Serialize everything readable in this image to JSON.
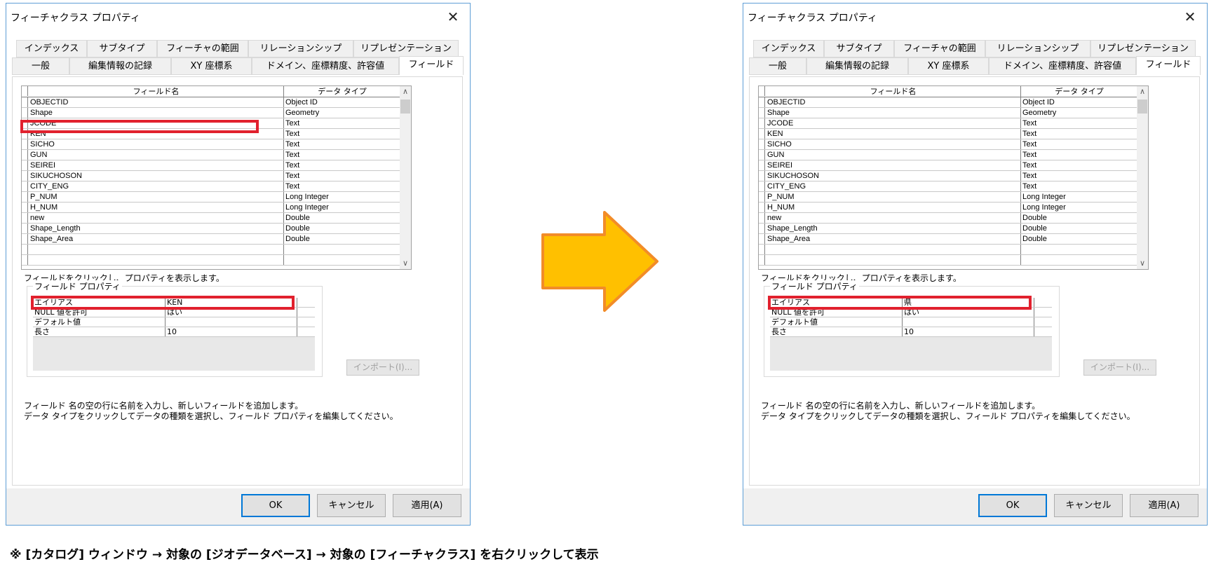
{
  "dialog_title": "フィーチャクラス プロパティ",
  "close_symbol": "✕",
  "tabs_row1": [
    "インデックス",
    "サブタイプ",
    "フィーチャの範囲",
    "リレーションシップ",
    "リプレゼンテーション"
  ],
  "tabs_row2": [
    "一般",
    "編集情報の記録",
    "XY 座標系",
    "ドメイン、座標精度、許容値",
    "フィールド"
  ],
  "active_tab": "フィールド",
  "grid": {
    "headers": [
      "フィールド名",
      "データ タイプ"
    ],
    "rows": [
      [
        "OBJECTID",
        "Object ID"
      ],
      [
        "Shape",
        "Geometry"
      ],
      [
        "JCODE",
        "Text"
      ],
      [
        "KEN",
        "Text"
      ],
      [
        "SICHO",
        "Text"
      ],
      [
        "GUN",
        "Text"
      ],
      [
        "SEIREI",
        "Text"
      ],
      [
        "SIKUCHOSON",
        "Text"
      ],
      [
        "CITY_ENG",
        "Text"
      ],
      [
        "P_NUM",
        "Long Integer"
      ],
      [
        "H_NUM",
        "Long Integer"
      ],
      [
        "new",
        "Double"
      ],
      [
        "Shape_Length",
        "Double"
      ],
      [
        "Shape_Area",
        "Double"
      ]
    ]
  },
  "click_hint": "フィールドをクリックし、プロパティを表示します。",
  "field_props_label": "フィールド プロパティ",
  "props_left": [
    [
      "エイリアス",
      "KEN"
    ],
    [
      "NULL 値を許可",
      "はい"
    ],
    [
      "デフォルト値",
      ""
    ],
    [
      "長さ",
      "10"
    ]
  ],
  "props_right": [
    [
      "エイリアス",
      "県"
    ],
    [
      "NULL 値を許可",
      "はい"
    ],
    [
      "デフォルト値",
      ""
    ],
    [
      "長さ",
      "10"
    ]
  ],
  "import_label": "インポート(I)...",
  "instructions": [
    "フィールド 名の空の行に名前を入力し、新しいフィールドを追加します。",
    "データ タイプをクリックしてデータの種類を選択し、フィールド プロパティを編集してください。"
  ],
  "buttons": {
    "ok": "OK",
    "cancel": "キャンセル",
    "apply": "適用(A)"
  },
  "caption": "※ [カタログ] ウィンドウ → 対象の [ジオデータベース] → 対象の [フィーチャクラス] を右クリックして表示",
  "colors": {
    "highlight": "#e1212e",
    "arrow_fill": "#ffc000",
    "arrow_stroke": "#f28c28",
    "window_border": "#5e9ed6"
  },
  "arrow_icon": "right-arrow-icon"
}
